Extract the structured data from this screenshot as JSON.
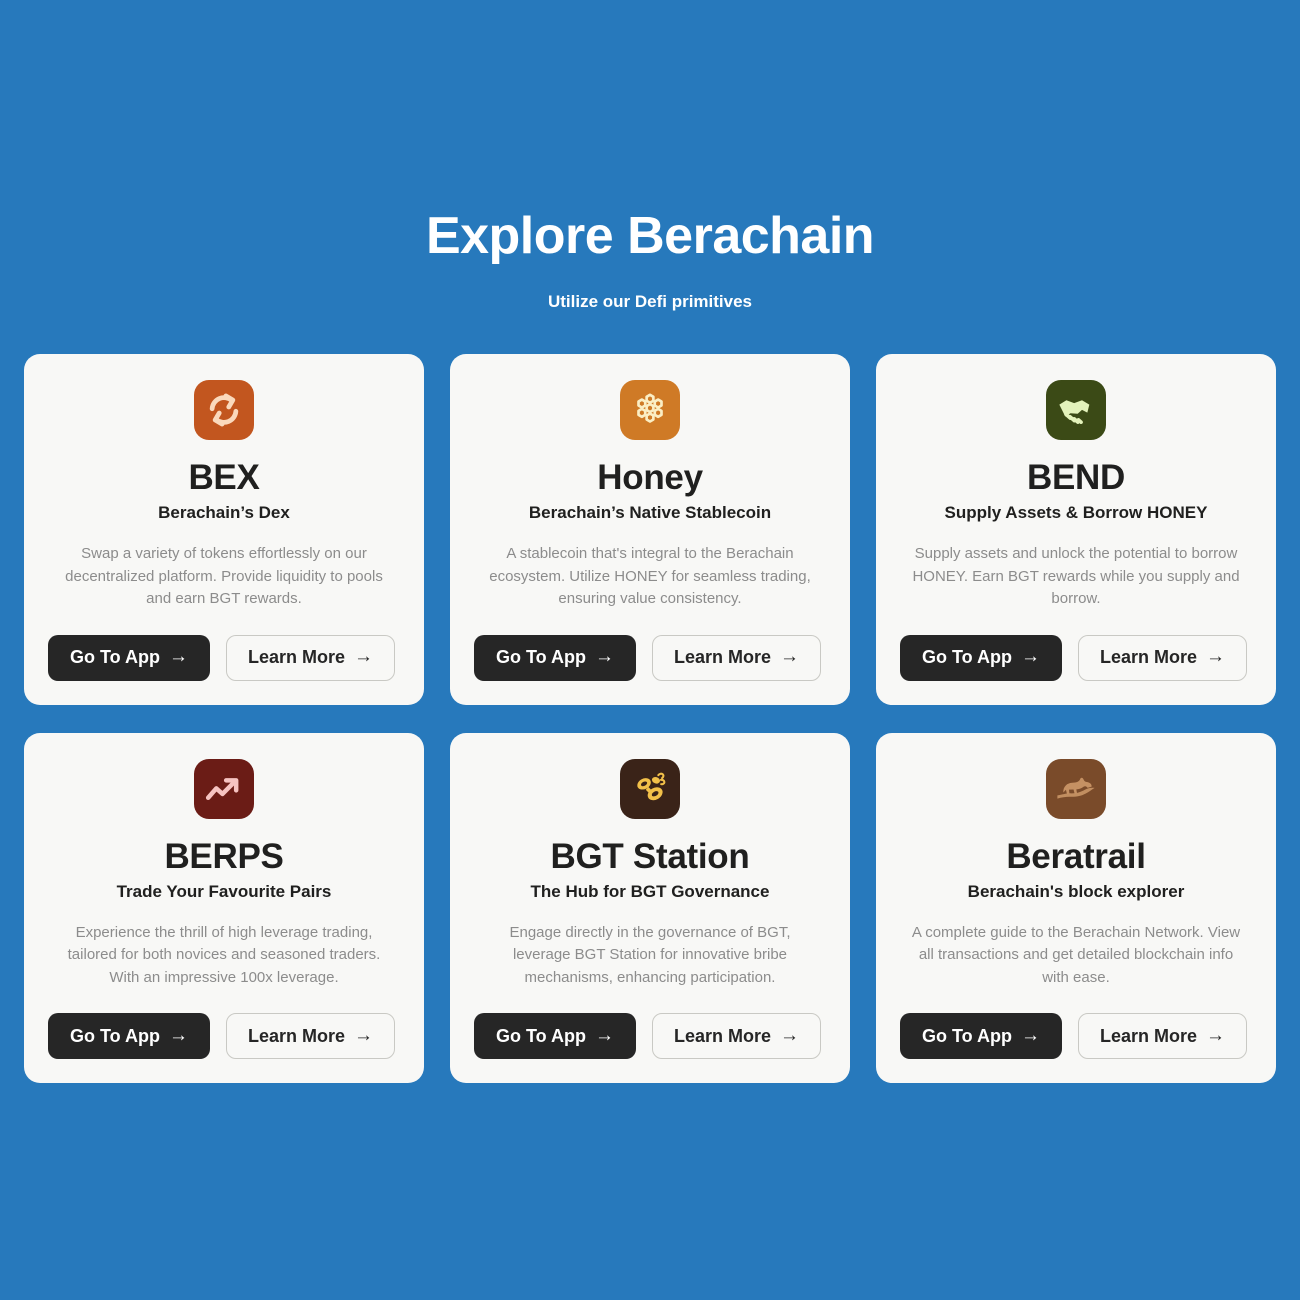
{
  "theme": {
    "background": "#2779bc",
    "card_background": "#f8f8f6",
    "title_color": "#20201f",
    "description_color": "#8c8c8c",
    "primary_button_bg": "#262626",
    "primary_button_text": "#ffffff",
    "secondary_button_border": "#c9c9c4"
  },
  "header": {
    "title": "Explore Berachain",
    "subtitle": "Utilize our Defi primitives"
  },
  "buttons": {
    "go_to_app_label": "Go To App",
    "learn_more_label": "Learn More",
    "arrow_glyph": "→"
  },
  "cards": [
    {
      "id": "bex",
      "icon_name": "swap-arrows-icon",
      "icon_bg": "#c2561f",
      "icon_fg": "#fad9bc",
      "title": "BEX",
      "subtitle": "Berachain’s Dex",
      "description": "Swap a variety of tokens effortlessly on our decentralized platform. Provide liquidity to pools and earn BGT rewards."
    },
    {
      "id": "honey",
      "icon_name": "honeycomb-icon",
      "icon_bg": "#cf7a26",
      "icon_fg": "#fbeec4",
      "title": "Honey",
      "subtitle": "Berachain’s Native Stablecoin",
      "description": "A stablecoin that's integral to the Berachain ecosystem. Utilize HONEY for seamless trading, ensuring value consistency."
    },
    {
      "id": "bend",
      "icon_name": "handshake-icon",
      "icon_bg": "#3b4a16",
      "icon_fg": "#e3f2bb",
      "title": "BEND",
      "subtitle": "Supply Assets & Borrow HONEY",
      "description": "Supply assets and unlock the potential to borrow HONEY. Earn BGT rewards while you supply and borrow."
    },
    {
      "id": "berps",
      "icon_name": "trending-up-chart-icon",
      "icon_bg": "#6b1c16",
      "icon_fg": "#f6c3c1",
      "title": "BERPS",
      "subtitle": "Trade Your Favourite Pairs",
      "description": "Experience the thrill of high leverage trading, tailored for both novices and seasoned traders. With an impressive 100x leverage."
    },
    {
      "id": "bgt-station",
      "icon_name": "bee-icon",
      "icon_bg": "#3a2318",
      "icon_fg": "#f2c049",
      "title": "BGT Station",
      "subtitle": "The Hub for BGT Governance",
      "description": "Engage directly in the governance of BGT, leverage BGT Station for innovative bribe mechanisms, enhancing participation."
    },
    {
      "id": "beratrail",
      "icon_name": "walking-bear-icon",
      "icon_bg": "#7a4b2a",
      "icon_fg": "#c59163",
      "title": "Beratrail",
      "subtitle": "Berachain's block explorer",
      "description": "A complete guide to the Berachain Network. View all transactions and get detailed blockchain info with ease."
    }
  ]
}
